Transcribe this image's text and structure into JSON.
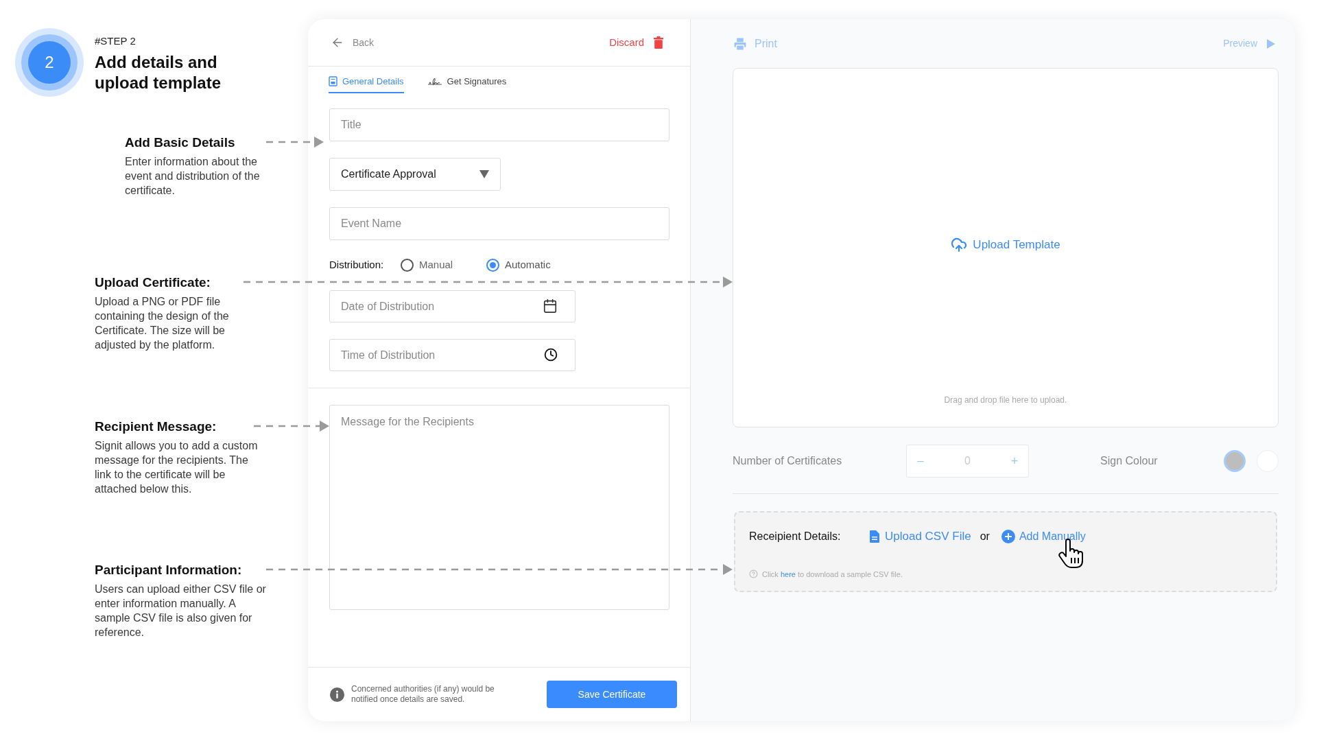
{
  "step": {
    "number": "2",
    "label": "#STEP 2",
    "title": "Add details and upload template"
  },
  "annotations": [
    {
      "heading": "Add Basic Details",
      "text": "Enter information about the event and distribution of the certificate."
    },
    {
      "heading": "Upload Certificate:",
      "text": "Upload a PNG or PDF file containing the design of the Certificate. The size will be adjusted by the platform."
    },
    {
      "heading": "Recipient Message:",
      "text": "Signit allows you to add a custom message for the recipients. The link to the certificate will be attached below this."
    },
    {
      "heading": "Participant Information:",
      "text": "Users can upload either CSV file or enter information manually. A sample CSV file is also given for reference."
    }
  ],
  "form": {
    "back": "Back",
    "discard": "Discard",
    "tabs": [
      {
        "kind": "details",
        "label": "General Details",
        "selected": true
      },
      {
        "kind": "signature",
        "label": "Get Signatures",
        "selected": false
      }
    ],
    "title_field": {
      "placeholder": "Title"
    },
    "type_select": {
      "value": "Certificate Approval"
    },
    "event_field": {
      "placeholder": "Event Name"
    },
    "distribution": {
      "label": "Distribution:",
      "options": [
        {
          "label": "Manual",
          "selected": false
        },
        {
          "label": "Automatic",
          "selected": true
        }
      ]
    },
    "date_field": {
      "placeholder": "Date of Distribution"
    },
    "time_field": {
      "placeholder": "Time of Distribution"
    },
    "message_field": {
      "placeholder": "Message for the Recipients"
    },
    "footer_note": "Concerned authorities (if any) would be notified once details are saved.",
    "save_button": "Save Certificate"
  },
  "preview": {
    "print": "Print",
    "preview": "Preview",
    "upload_template": "Upload Template",
    "drop_hint": "Drag and drop file here to upload.",
    "certificates": {
      "label": "Number of Certificates",
      "minus": "–",
      "value": "0",
      "plus": "+"
    },
    "sign_colour": {
      "label": "Sign Colour",
      "swatches": [
        {
          "color": "#bdbdbd",
          "selected": true
        },
        {
          "color": "#ffffff",
          "selected": false
        }
      ]
    },
    "recipients": {
      "label": "Receipient Details:",
      "upload_csv": "Upload CSV File",
      "or": "or",
      "add_manually": "Add Manually",
      "hint_before": "Click",
      "hint_link": "here",
      "hint_after": "to download a sample CSV file."
    }
  }
}
